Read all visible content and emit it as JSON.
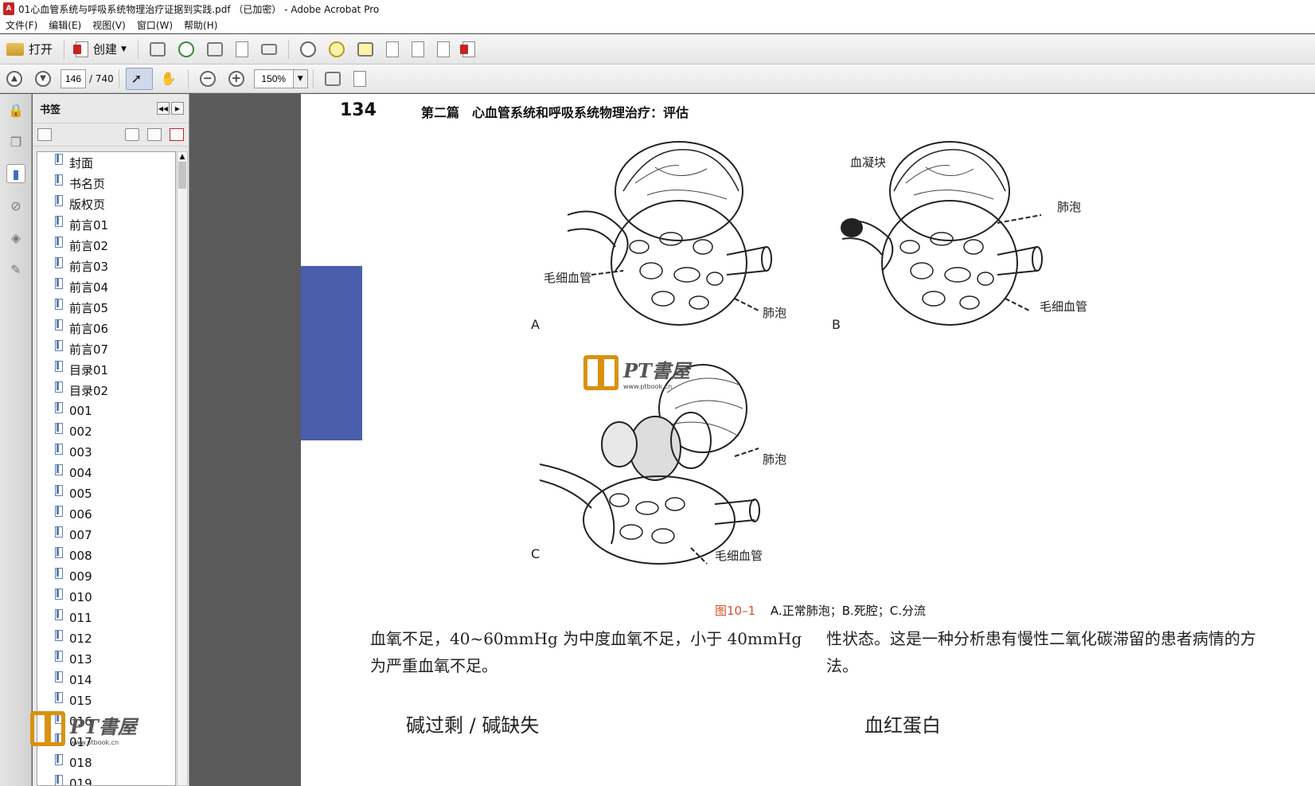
{
  "titlebar": {
    "title": "01心血管系统与呼吸系统物理治疗证据到实践.pdf （已加密） - Adobe Acrobat Pro"
  },
  "menu": [
    "文件(F)",
    "编辑(E)",
    "视图(V)",
    "窗口(W)",
    "帮助(H)"
  ],
  "toolbar1": {
    "open_label": "打开",
    "create_label": "创建"
  },
  "toolbar2": {
    "page_value": "146",
    "page_total": "/ 740",
    "zoom_value": "150%"
  },
  "bookmarks": {
    "title": "书签",
    "items": [
      "封面",
      "书名页",
      "版权页",
      "前言01",
      "前言02",
      "前言03",
      "前言04",
      "前言05",
      "前言06",
      "前言07",
      "目录01",
      "目录02",
      "001",
      "002",
      "003",
      "004",
      "005",
      "006",
      "007",
      "008",
      "009",
      "010",
      "011",
      "012",
      "013",
      "014",
      "015",
      "016",
      "017",
      "018",
      "019"
    ]
  },
  "watermark": {
    "brand": "PT書屋",
    "url": "www.ptbook.cn"
  },
  "page": {
    "page_number": "134",
    "running_head": "第二篇　心血管系统和呼吸系统物理治疗：评估",
    "figure": {
      "labels": {
        "a_capillary": "毛细血管",
        "a_alveolus": "肺泡",
        "a_letter": "A",
        "b_clot": "血凝块",
        "b_alveolus": "肺泡",
        "b_capillary": "毛细血管",
        "b_letter": "B",
        "c_alveolus": "肺泡",
        "c_capillary": "毛细血管",
        "c_letter": "C"
      },
      "caption_num": "图10–1",
      "caption_text": "A.正常肺泡；B.死腔；C.分流"
    },
    "col1_text": "血氧不足，40~60mmHg 为中度血氧不足，小于 40mmHg 为严重血氧不足。",
    "col2_text": "性状态。这是一种分析患有慢性二氧化碳滞留的患者病情的方法。",
    "col1_heading": "碱过剩 / 碱缺失",
    "col2_heading": "血红蛋白"
  }
}
